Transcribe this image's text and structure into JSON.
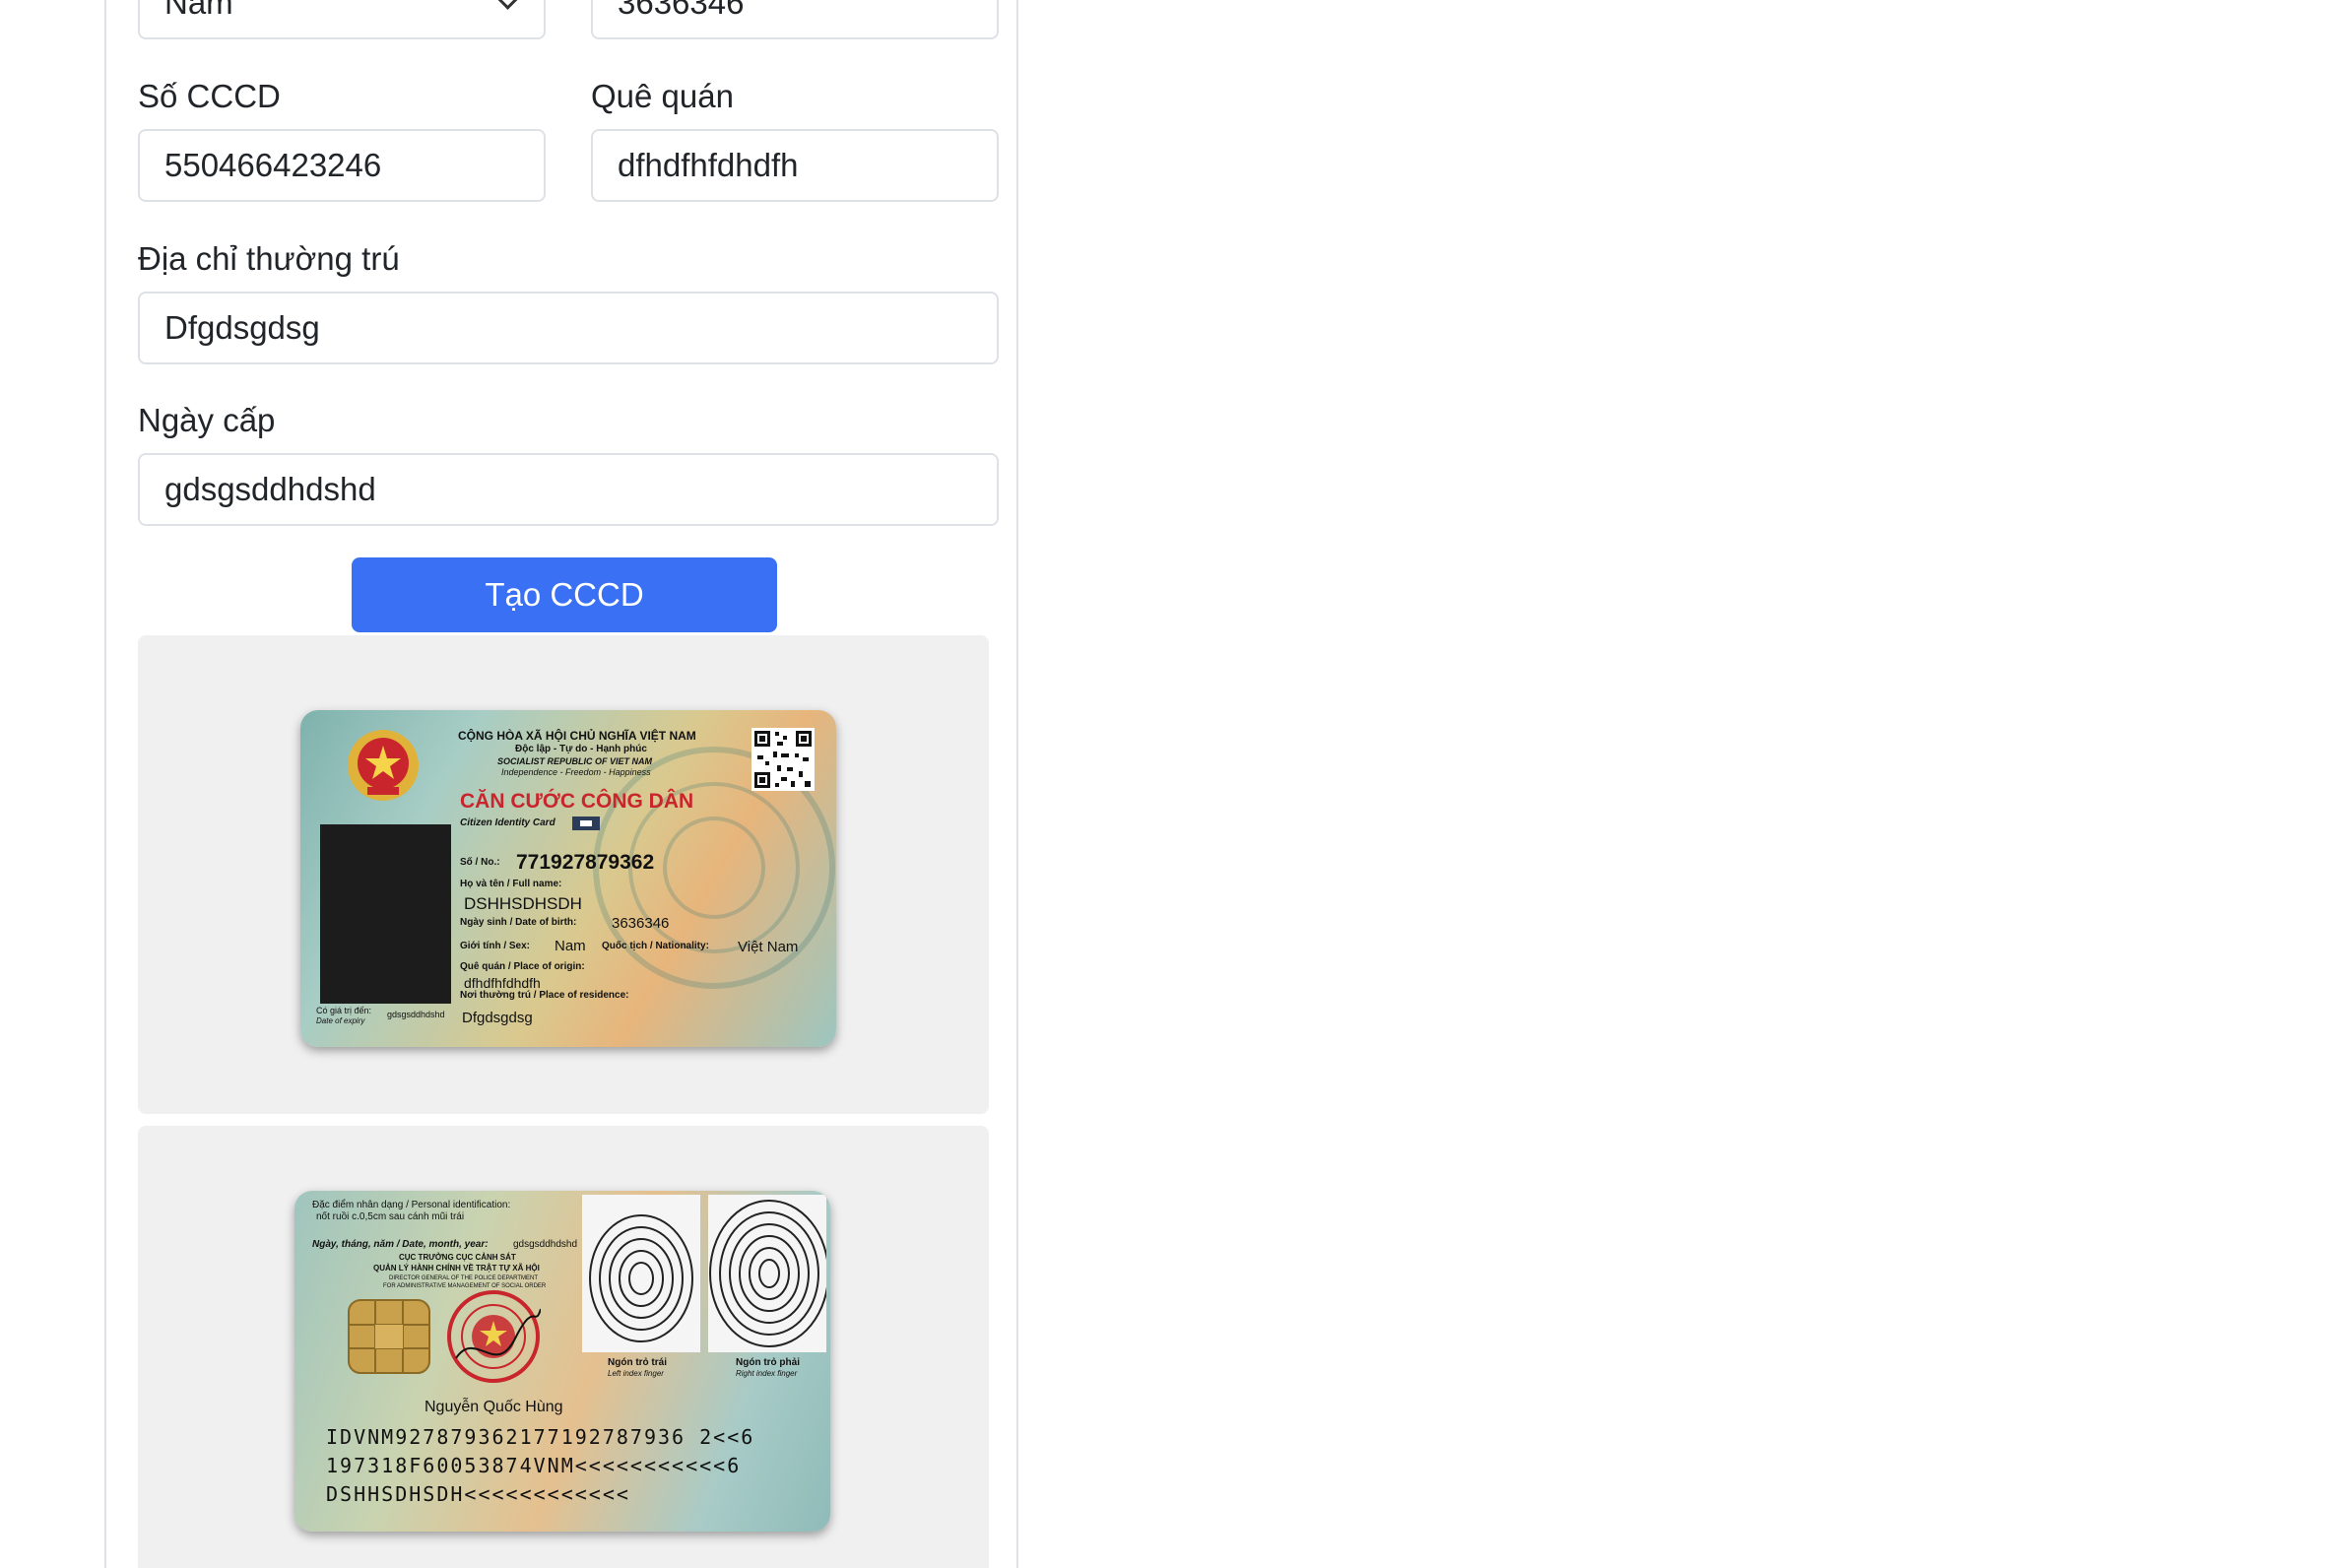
{
  "form": {
    "gender": {
      "value": "Nam"
    },
    "dob_field": {
      "value": "3636346"
    },
    "id_number": {
      "label": "Số CCCD",
      "value": "550466423246"
    },
    "hometown": {
      "label": "Quê quán",
      "value": "dfhdfhfdhdfh"
    },
    "address": {
      "label": "Địa chỉ thường trú",
      "value": "Dfgdsgdsg"
    },
    "issue_date": {
      "label": "Ngày cấp",
      "value": "gdsgsddhdshd"
    },
    "submit_label": "Tạo CCCD"
  },
  "card_front": {
    "country": "CỘNG HÒA XÃ HỘI CHỦ NGHĨA VIỆT NAM",
    "motto": "Độc lập - Tự do - Hạnh phúc",
    "country_en": "SOCIALIST REPUBLIC OF VIET NAM",
    "motto_en": "Independence - Freedom - Happiness",
    "card_title": "CĂN CƯỚC CÔNG DÂN",
    "card_title_en": "Citizen Identity Card",
    "no_label": "Số / No.:",
    "no_value": "771927879362",
    "name_label": "Họ và tên / Full name:",
    "name_value": "DSHHSDHSDH",
    "dob_label": "Ngày sinh / Date of birth:",
    "dob_value": "3636346",
    "sex_label": "Giới tính / Sex:",
    "sex_value": "Nam",
    "nationality_label": "Quốc tịch / Nationality:",
    "nationality_value": "Việt Nam",
    "origin_label": "Quê quán / Place of origin:",
    "origin_value": "dfhdfhfdhdfh",
    "residence_label": "Nơi thường trú / Place of residence:",
    "residence_value": "Dfgdsgdsg",
    "expiry_label": "Có giá trị đến:",
    "expiry_label_en": "Date of expiry",
    "expiry_value": "gdsgsddhdshd"
  },
  "card_back": {
    "ident_label": "Đặc điểm nhân dạng / Personal identification:",
    "ident_value": "nốt ruồi c.0,5cm sau cánh mũi trái",
    "date_label": "Ngày, tháng, năm / Date, month, year:",
    "date_value": "gdsgsddhdshd",
    "agency_1": "CỤC TRƯỞNG CỤC CẢNH SÁT",
    "agency_2": "QUẢN LÝ HÀNH CHÍNH VỀ TRẬT TỰ XÃ HỘI",
    "agency_3": "DIRECTOR GENERAL OF THE POLICE DEPARTMENT",
    "agency_4": "FOR ADMINISTRATIVE MANAGEMENT OF SOCIAL ORDER",
    "left_finger": "Ngón trỏ trái",
    "left_finger_en": "Left index finger",
    "right_finger": "Ngón trỏ phải",
    "right_finger_en": "Right index finger",
    "signer": "Nguyễn Quốc Hùng",
    "mrz_1": "IDVNM927879362177192787936 2<<6",
    "mrz_2": "197318F60053874VNM<<<<<<<<<<<6",
    "mrz_3": "DSHHSDHSDH<<<<<<<<<<<<"
  }
}
